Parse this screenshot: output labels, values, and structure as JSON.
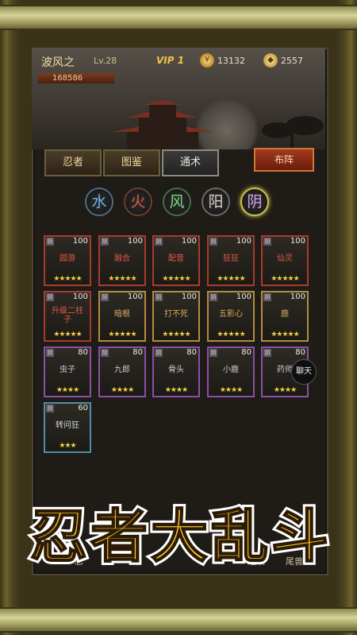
{
  "player": {
    "name": "波风之",
    "level": "Lv.28",
    "power": "168586",
    "vip": "VIP 1",
    "coins": "13132",
    "gems": "2557"
  },
  "tabs": [
    {
      "label": "忍者"
    },
    {
      "label": "图鉴"
    },
    {
      "label": "通术"
    }
  ],
  "formation_label": "布阵",
  "elements": [
    "水",
    "火",
    "风",
    "阳",
    "阴"
  ],
  "cards": [
    {
      "name": "园游",
      "level": "100",
      "stars": "★★★★★",
      "rarity": "red"
    },
    {
      "name": "融合",
      "level": "100",
      "stars": "★★★★★",
      "rarity": "red"
    },
    {
      "name": "配音",
      "level": "100",
      "stars": "★★★★★",
      "rarity": "red"
    },
    {
      "name": "狂狂",
      "level": "100",
      "stars": "★★★★★",
      "rarity": "red"
    },
    {
      "name": "仙灵",
      "level": "100",
      "stars": "★★★★★",
      "rarity": "red"
    },
    {
      "name": "升级二柱子",
      "level": "100",
      "stars": "★★★★★",
      "rarity": "red"
    },
    {
      "name": "暗根",
      "level": "100",
      "stars": "★★★★★",
      "rarity": "gold"
    },
    {
      "name": "打不死",
      "level": "100",
      "stars": "★★★★★",
      "rarity": "gold"
    },
    {
      "name": "五影心",
      "level": "100",
      "stars": "★★★★★",
      "rarity": "gold"
    },
    {
      "name": "鹿",
      "level": "100",
      "stars": "★★★★★",
      "rarity": "gold"
    },
    {
      "name": "虫子",
      "level": "80",
      "stars": "★★★★",
      "rarity": "purple"
    },
    {
      "name": "九郎",
      "level": "80",
      "stars": "★★★★",
      "rarity": "purple"
    },
    {
      "name": "骨头",
      "level": "80",
      "stars": "★★★★",
      "rarity": "purple"
    },
    {
      "name": "小鹿",
      "level": "80",
      "stars": "★★★★",
      "rarity": "purple"
    },
    {
      "name": "药师",
      "level": "80",
      "stars": "★★★★",
      "rarity": "purple"
    },
    {
      "name": "转问狂",
      "level": "60",
      "stars": "★★★",
      "rarity": "blue"
    }
  ],
  "card_tag": "阴",
  "chat_label": "聊天",
  "bottom_menu": [
    "忍",
    "组织",
    "尾兽"
  ],
  "game_title": "忍者大乱斗",
  "colors": {
    "title_gold": "#f7c52a",
    "title_outline": "#ffffff",
    "title_stroke": "#2b1a05"
  }
}
